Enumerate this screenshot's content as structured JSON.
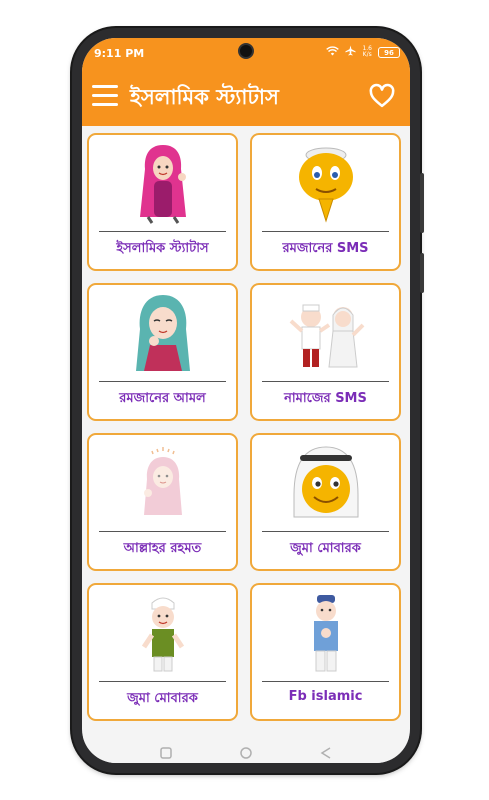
{
  "status": {
    "time": "9:11 PM",
    "icons": [
      "wifi-icon",
      "airplane-icon",
      "signal-icon"
    ],
    "battery": "96"
  },
  "appbar": {
    "title": "ইসলামিক স্ট্যাটাস",
    "color": "#f7931e",
    "icons": [
      "menu-icon",
      "heart-icon"
    ]
  },
  "cards": [
    {
      "label": "ইসলামিক স্ট্যাটাস",
      "icon": "hijab-girl-icon"
    },
    {
      "label": "রমজানের SMS",
      "icon": "praying-emoji-icon"
    },
    {
      "label": "রমজানের আমল",
      "icon": "hijab-girl-teal-icon"
    },
    {
      "label": "নামাজের SMS",
      "icon": "waving-kids-icon"
    },
    {
      "label": "আল্লাহর রহমত",
      "icon": "pink-hijab-child-icon"
    },
    {
      "label": "জুমা মোবারক",
      "icon": "arab-emoji-icon"
    },
    {
      "label": "জুমা মোবারক",
      "icon": "thumbs-up-boy-icon"
    },
    {
      "label": "Fb islamic",
      "icon": "praying-boy-icon"
    }
  ],
  "navbar": {
    "icons": [
      "recents-icon",
      "home-icon",
      "back-icon"
    ]
  }
}
